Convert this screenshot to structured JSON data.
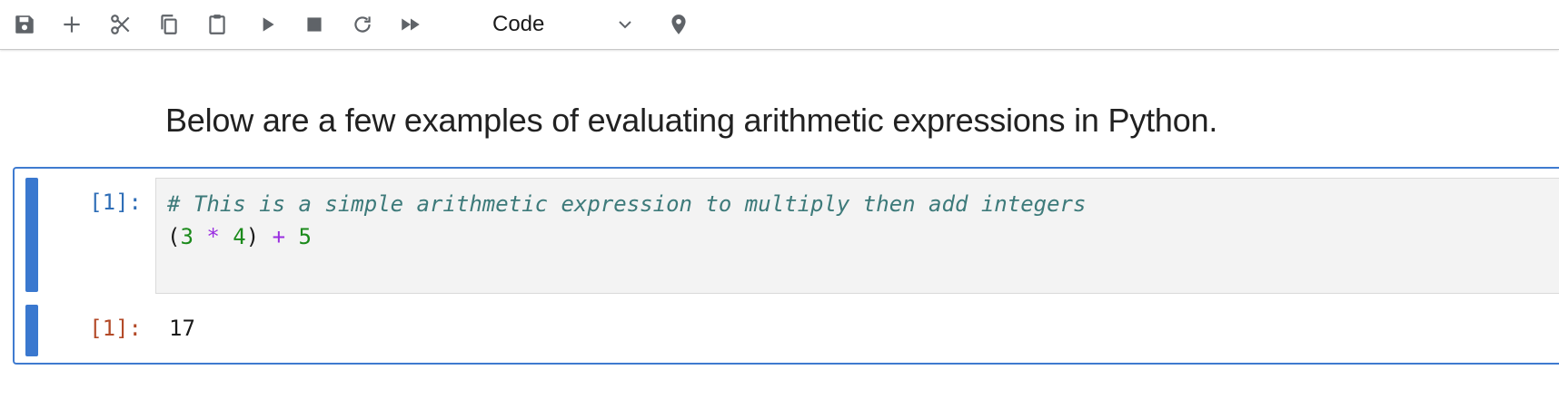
{
  "toolbar": {
    "buttons": [
      {
        "name": "save-icon"
      },
      {
        "name": "add-cell-icon"
      },
      {
        "name": "cut-icon"
      },
      {
        "name": "copy-icon"
      },
      {
        "name": "paste-icon"
      },
      {
        "name": "run-icon"
      },
      {
        "name": "stop-icon"
      },
      {
        "name": "restart-icon"
      },
      {
        "name": "run-all-icon"
      }
    ],
    "cell_type": "Code",
    "extra_icon": "map-pin-icon"
  },
  "markdown": {
    "text": "Below are a few examples of evaluating arithmetic expressions in Python."
  },
  "code_cell": {
    "input_prompt": "[1]:",
    "comment": "# This is a simple arithmetic expression to multiply then add integers",
    "tokens": {
      "open_paren": "(",
      "num1": "3",
      "op1": "*",
      "num2": "4",
      "close_paren": ")",
      "op2": "+",
      "num3": "5"
    },
    "output_prompt": "[1]:",
    "output": "17"
  },
  "colors": {
    "accent": "#3a78cf",
    "input_prompt": "#2f6eb7",
    "output_prompt": "#b34a28",
    "comment": "#3d7a7a",
    "number": "#1b8a1b",
    "operator": "#9a2ee0"
  }
}
